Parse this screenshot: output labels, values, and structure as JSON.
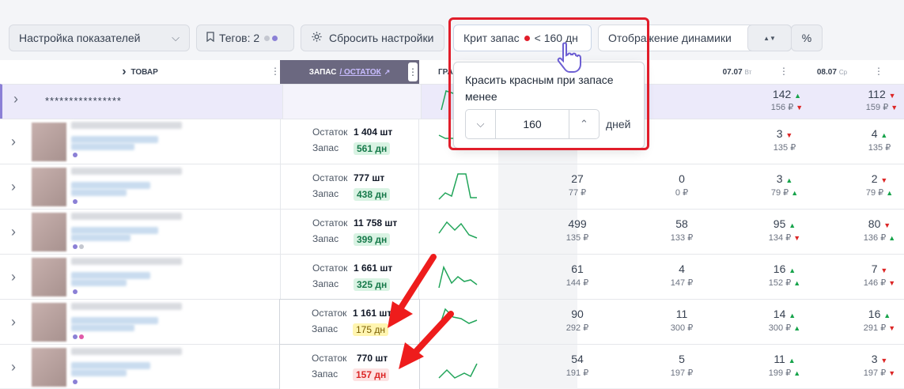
{
  "toolbar": {
    "settings_label": "Настройка показателей",
    "tags_label": "Тегов: 2",
    "reset_label": "Сбросить настройки",
    "crit_label": "Крит запас",
    "crit_value": "< 160 дн",
    "dynamics_label": "Отображение динамики",
    "percent_label": "%"
  },
  "columns": {
    "product": "ТОВАР",
    "stock": "ЗАПАС",
    "stock_link": "/ ОСТАТОК",
    "graph": "ГРА",
    "d1_date": "07.07",
    "d1_day": "Вт",
    "d2_date": "08.07",
    "d2_day": "Ср"
  },
  "summary_row": {
    "name": "****************",
    "c3_main": "142",
    "c3_sub": "156 ₽",
    "c4_main": "112",
    "c4_sub": "159 ₽"
  },
  "labels": {
    "ostatok": "Остаток",
    "zapas": "Запас"
  },
  "rows": [
    {
      "ostatok": "1 404 шт",
      "zapas": "561 дн",
      "a_main": "",
      "a_sub": "",
      "b_main": "",
      "b_sub": "",
      "c_main": "3",
      "c_sub": "135 ₽",
      "d_main": "4",
      "d_sub": "135 ₽"
    },
    {
      "ostatok": "777 шт",
      "zapas": "438 дн",
      "a_main": "27",
      "a_sub": "77 ₽",
      "b_main": "0",
      "b_sub": "0 ₽",
      "c_main": "3",
      "c_sub": "79 ₽",
      "d_main": "2",
      "d_sub": "79 ₽"
    },
    {
      "ostatok": "11 758 шт",
      "zapas": "399 дн",
      "a_main": "499",
      "a_sub": "135 ₽",
      "b_main": "58",
      "b_sub": "133 ₽",
      "c_main": "95",
      "c_sub": "134 ₽",
      "d_main": "80",
      "d_sub": "136 ₽"
    },
    {
      "ostatok": "1 661 шт",
      "zapas": "325 дн",
      "a_main": "61",
      "a_sub": "144 ₽",
      "b_main": "4",
      "b_sub": "147 ₽",
      "c_main": "16",
      "c_sub": "152 ₽",
      "d_main": "7",
      "d_sub": "146 ₽"
    },
    {
      "ostatok": "1 161 шт",
      "zapas": "175 дн",
      "a_main": "90",
      "a_sub": "292 ₽",
      "b_main": "11",
      "b_sub": "300 ₽",
      "c_main": "14",
      "c_sub": "300 ₽",
      "d_main": "16",
      "d_sub": "291 ₽"
    },
    {
      "ostatok": "770 шт",
      "zapas": "157 дн",
      "a_main": "54",
      "a_sub": "191 ₽",
      "b_main": "5",
      "b_sub": "197 ₽",
      "c_main": "11",
      "c_sub": "199 ₽",
      "d_main": "3",
      "d_sub": "197 ₽"
    }
  ],
  "popup": {
    "title": "Красить красным при запасе менее",
    "value": "160",
    "unit": "дней"
  },
  "colors": {
    "accent": "#6d5fd3",
    "critical_red": "#e11d2a",
    "badge_green": "#d9f3e3",
    "badge_yellow": "#fff5b0",
    "badge_red": "#fde2e2"
  }
}
